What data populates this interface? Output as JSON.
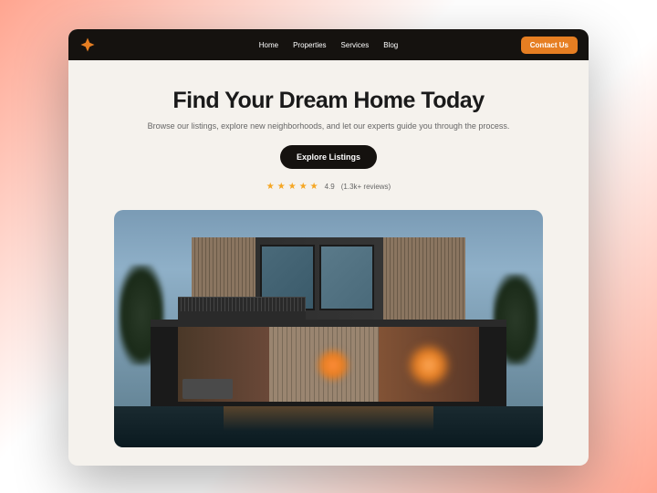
{
  "nav": {
    "links": [
      "Home",
      "Properties",
      "Services",
      "Blog"
    ],
    "contact_label": "Contact Us"
  },
  "hero": {
    "title": "Find Your Dream Home Today",
    "subtitle": "Browse our listings, explore new neighborhoods, and let our experts guide you through the process.",
    "cta_label": "Explore Listings",
    "rating_value": "4.9",
    "rating_reviews": "(1.3k+ reviews)"
  },
  "icons": {
    "logo": "star-logo",
    "star": "★"
  },
  "colors": {
    "accent": "#e67e22",
    "navbar": "#15120f",
    "bg": "#f5f2ed",
    "star": "#f5a623"
  }
}
